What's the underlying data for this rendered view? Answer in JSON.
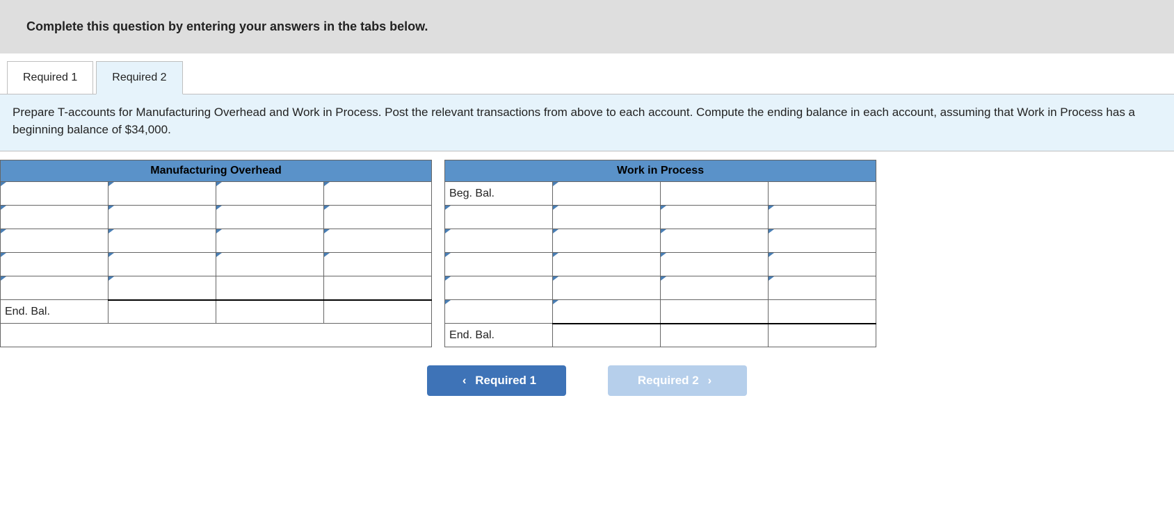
{
  "banner": "Complete this question by entering your answers in the tabs below.",
  "tabs": {
    "t1": "Required 1",
    "t2": "Required 2"
  },
  "prompt": "Prepare T-accounts for Manufacturing Overhead and Work in Process. Post the relevant transactions from above to each account. Compute the ending balance in each account, assuming that Work in Process has a beginning balance of $34,000.",
  "accounts": {
    "mo": {
      "title": "Manufacturing Overhead",
      "end_label": "End. Bal."
    },
    "wip": {
      "title": "Work in Process",
      "beg_label": "Beg. Bal.",
      "end_label": "End. Bal."
    }
  },
  "nav": {
    "prev": "Required 1",
    "next": "Required 2"
  }
}
